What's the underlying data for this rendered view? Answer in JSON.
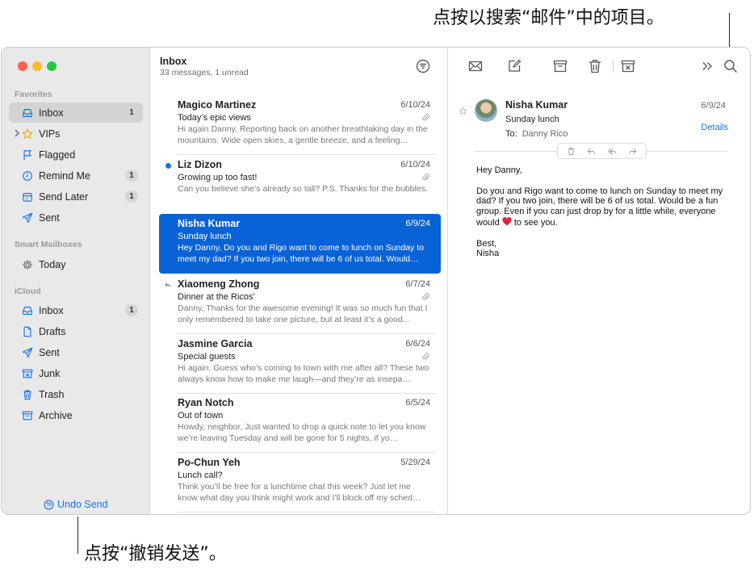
{
  "callouts": {
    "top": "点按以搜索“邮件”中的项目。",
    "bottom": "点按“撤销发送”。"
  },
  "colors": {
    "accent": "#1a73e8",
    "selection": "#0a63d6",
    "traffic_red": "#ff5f57",
    "traffic_yellow": "#febc2e",
    "traffic_green": "#28c840",
    "heart": "#e0243c"
  },
  "sidebar": {
    "favorites_header": "Favorites",
    "smart_header": "Smart Mailboxes",
    "icloud_header": "iCloud",
    "favorites": [
      {
        "label": "Inbox",
        "icon": "inbox-icon",
        "badge": "1"
      },
      {
        "label": "VIPs",
        "icon": "star-icon",
        "badge": ""
      },
      {
        "label": "Flagged",
        "icon": "flag-icon",
        "badge": ""
      },
      {
        "label": "Remind Me",
        "icon": "clock-icon",
        "badge": "1"
      },
      {
        "label": "Send Later",
        "icon": "calendar-icon",
        "badge": "1"
      },
      {
        "label": "Sent",
        "icon": "paperplane-icon",
        "badge": ""
      }
    ],
    "smart": [
      {
        "label": "Today",
        "icon": "gear-icon"
      }
    ],
    "icloud": [
      {
        "label": "Inbox",
        "icon": "inbox-icon",
        "badge": "1"
      },
      {
        "label": "Drafts",
        "icon": "document-icon",
        "badge": ""
      },
      {
        "label": "Sent",
        "icon": "paperplane-icon",
        "badge": ""
      },
      {
        "label": "Junk",
        "icon": "junk-icon",
        "badge": ""
      },
      {
        "label": "Trash",
        "icon": "trash-icon",
        "badge": ""
      },
      {
        "label": "Archive",
        "icon": "archive-icon",
        "badge": ""
      }
    ],
    "undo_send": "Undo Send"
  },
  "list": {
    "title": "Inbox",
    "subtitle": "33 messages, 1 unread",
    "messages": [
      {
        "from": "Magico Martinez",
        "date": "6/10/24",
        "subject": "Today’s epic views",
        "preview": "Hi again Danny, Reporting back on another breathtaking day in the mountains. Wide open skies, a gentle breeze, and a feeling…"
      },
      {
        "from": "Liz Dizon",
        "date": "6/10/24",
        "subject": "Growing up too fast!",
        "preview": "Can you believe she’s already so tall? P.S. Thanks for the bubbles."
      },
      {
        "from": "Nisha Kumar",
        "date": "6/9/24",
        "subject": "Sunday lunch",
        "preview": "Hey Danny, Do you and Rigo want to come to lunch on Sunday to meet my dad? If you two join, there will be 6 of us total. Would…"
      },
      {
        "from": "Xiaomeng Zhong",
        "date": "6/7/24",
        "subject": "Dinner at the Ricos’",
        "preview": "Danny, Thanks for the awesome evening! It was so much fun that I only remembered to take one picture, but at least it’s a good…"
      },
      {
        "from": "Jasmine Garcia",
        "date": "6/6/24",
        "subject": "Special guests",
        "preview": "Hi again. Guess who’s coming to town with me after all? These two always know how to make me laugh—and they’re as insepa…"
      },
      {
        "from": "Ryan Notch",
        "date": "6/5/24",
        "subject": "Out of town",
        "preview": "Howdy, neighbor, Just wanted to drop a quick note to let you know we’re leaving Tuesday and will be gone for 5 nights, if yo…"
      },
      {
        "from": "Po-Chun Yeh",
        "date": "5/29/24",
        "subject": "Lunch call?",
        "preview": "Think you’ll be free for a lunchtime chat this week? Just let me know what day you think might work and I’ll block off my sched…"
      }
    ]
  },
  "reader": {
    "from": "Nisha Kumar",
    "date": "6/9/24",
    "subject": "Sunday lunch",
    "to_label": "To:",
    "to_name": "Danny Rico",
    "details": "Details",
    "greeting": "Hey Danny,",
    "body_before_heart": "Do you and Rigo want to come to lunch on Sunday to meet my dad? If you two join, there will be 6 of us total. Would be a fun group. Even if you can just drop by for a little while, everyone would",
    "body_after_heart": "to see you.",
    "signoff": "Best,",
    "signature": "Nisha"
  }
}
